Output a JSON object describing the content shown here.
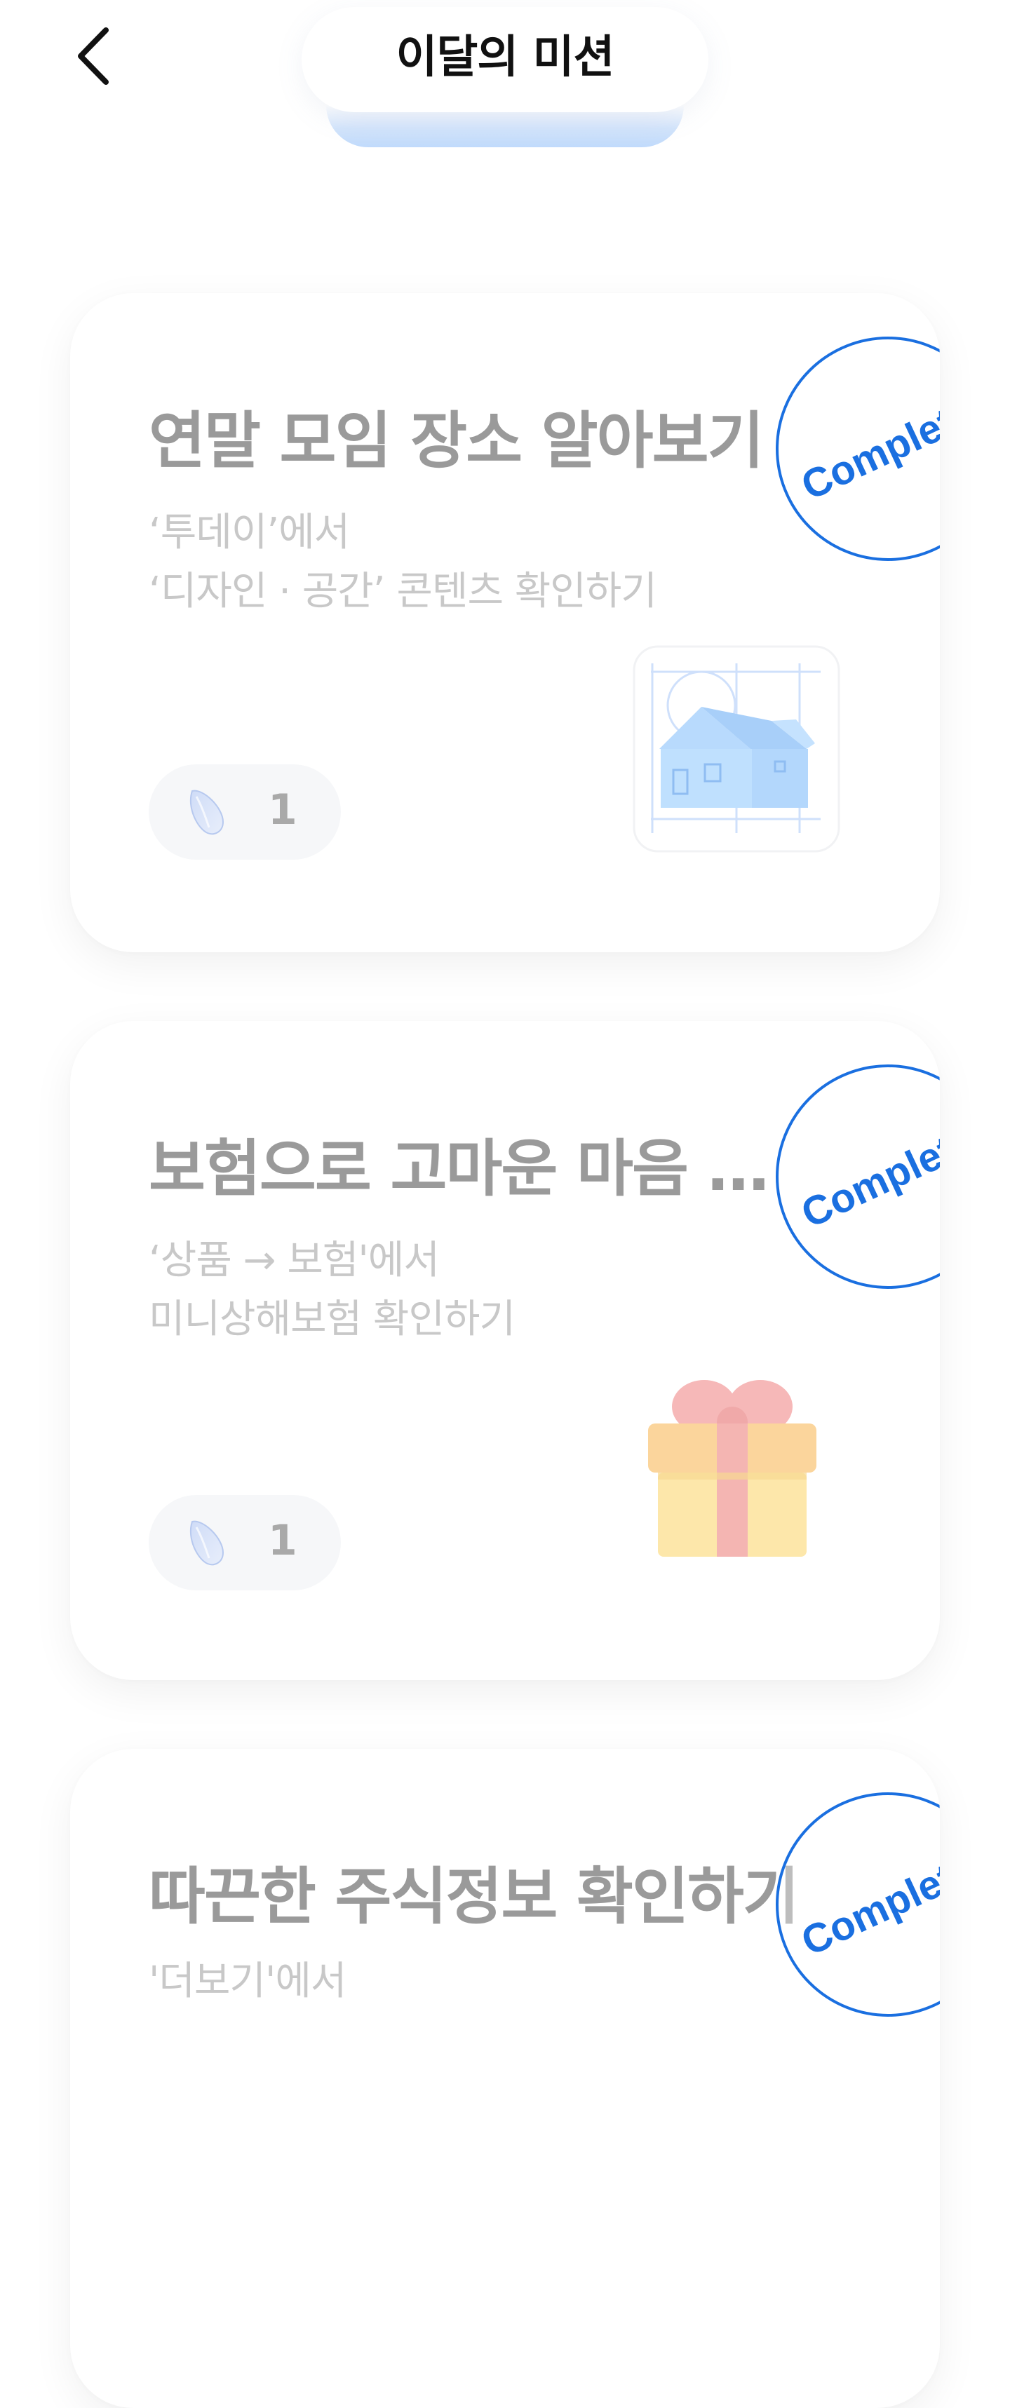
{
  "header": {
    "title": "이달의 미션"
  },
  "stamp_label": "Complete",
  "colors": {
    "stamp": "#1a6fe0",
    "title_text": "#9a9a9a",
    "desc_text": "#c8c8c8"
  },
  "missions": [
    {
      "title": "연말 모임 장소 알아보기",
      "desc_line1": "‘투데이’에서",
      "desc_line2": "‘디자인 · 공간’ 콘텐츠 확인하기",
      "reward": "1",
      "icon": "house-blueprint-icon"
    },
    {
      "title": "보험으로 고마운 마음 전…",
      "desc_line1": "‘상품 → 보험'에서",
      "desc_line2": "미니상해보험 확인하기",
      "reward": "1",
      "icon": "gift-box-icon"
    },
    {
      "title": "따끈한 주식정보 확인하기",
      "desc_line1": "'더보기'에서",
      "desc_line2": "",
      "reward": "",
      "icon": ""
    }
  ]
}
